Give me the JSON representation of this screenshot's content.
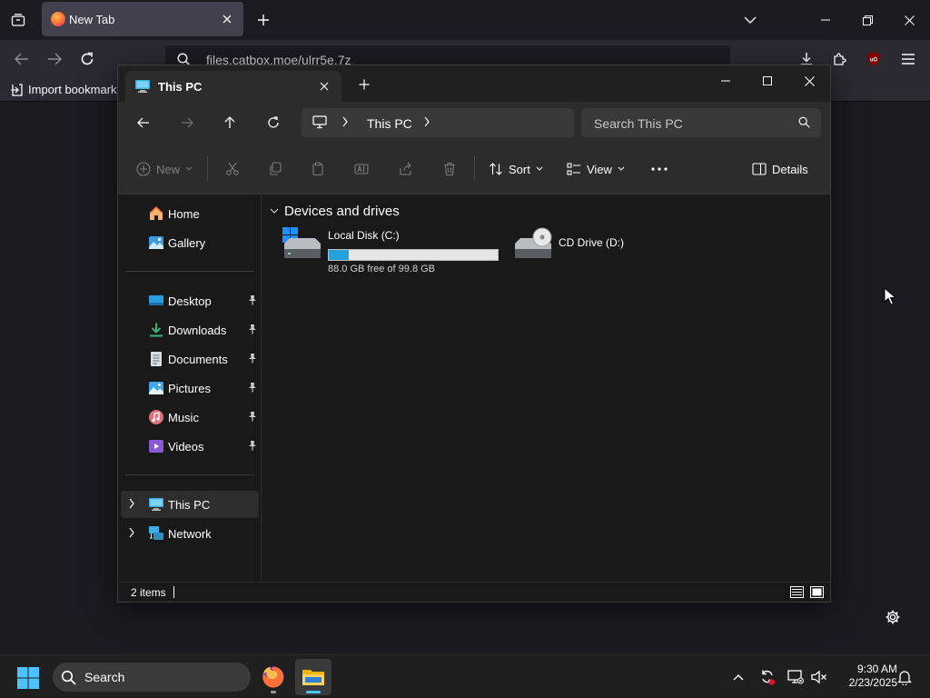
{
  "browser": {
    "tab_title": "New Tab",
    "url": "files.catbox.moe/ulrr5e.7z",
    "bookmarks_import_label": "Import bookmarks"
  },
  "explorer": {
    "tab_title": "This PC",
    "breadcrumb": [
      "This PC"
    ],
    "search_placeholder": "Search This PC",
    "commands": {
      "new_label": "New",
      "sort_label": "Sort",
      "view_label": "View",
      "details_label": "Details"
    },
    "nav": {
      "quick": [
        {
          "label": "Home",
          "icon": "home-icon"
        },
        {
          "label": "Gallery",
          "icon": "gallery-icon"
        }
      ],
      "pinned": [
        {
          "label": "Desktop",
          "icon": "desktop-folder-icon"
        },
        {
          "label": "Downloads",
          "icon": "downloads-folder-icon"
        },
        {
          "label": "Documents",
          "icon": "documents-folder-icon"
        },
        {
          "label": "Pictures",
          "icon": "pictures-folder-icon"
        },
        {
          "label": "Music",
          "icon": "music-folder-icon"
        },
        {
          "label": "Videos",
          "icon": "videos-folder-icon"
        }
      ],
      "tree": [
        {
          "label": "This PC",
          "icon": "this-pc-icon",
          "selected": true
        },
        {
          "label": "Network",
          "icon": "network-icon",
          "selected": false
        }
      ]
    },
    "group_header": "Devices and drives",
    "drives": [
      {
        "name": "Local Disk (C:)",
        "free_text": "88.0 GB free of 99.8 GB",
        "used_fraction": 0.118
      },
      {
        "name": "CD Drive (D:)"
      }
    ],
    "status": {
      "item_count": "2 items"
    }
  },
  "taskbar": {
    "search_label": "Search",
    "time": "9:30 AM",
    "date": "2/23/2025",
    "apps": [
      "firefox-icon",
      "file-explorer-icon"
    ]
  },
  "colors": {
    "accent": "#26a0da",
    "taskbar_indicator": "#4cc2ff"
  }
}
